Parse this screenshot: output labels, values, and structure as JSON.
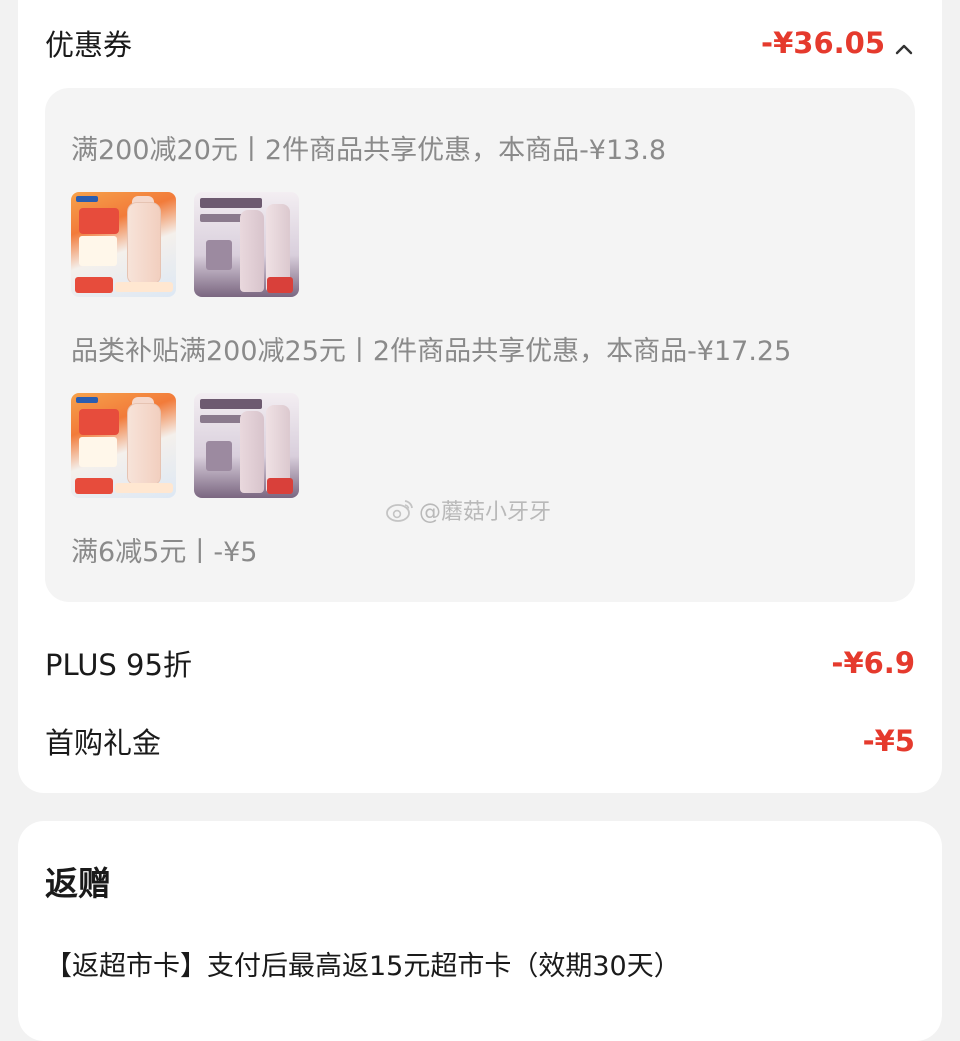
{
  "coupon": {
    "label": "优惠券",
    "value": "-¥36.05",
    "chevron_icon": "chevron-up-icon",
    "items": [
      {
        "text": "满200减20元丨2件商品共享优惠，本商品-¥13.8",
        "products": [
          "baby-bottle-product",
          "shampoo-product"
        ]
      },
      {
        "text": "品类补贴满200减25元丨2件商品共享优惠，本商品-¥17.25",
        "products": [
          "baby-bottle-product",
          "shampoo-product"
        ]
      },
      {
        "text": "满6减5元丨-¥5"
      }
    ]
  },
  "plus": {
    "label": "PLUS 95折",
    "value": "-¥6.9"
  },
  "first_purchase": {
    "label": "首购礼金",
    "value": "-¥5"
  },
  "gift": {
    "title": "返赠",
    "text": "【返超市卡】支付后最高返15元超市卡（效期30天）"
  },
  "watermark": {
    "icon": "weibo-icon",
    "text": "@蘑菇小牙牙"
  },
  "colors": {
    "accent": "#e53a2d",
    "panel": "#f4f4f4",
    "muted_text": "#8a8a8a"
  }
}
